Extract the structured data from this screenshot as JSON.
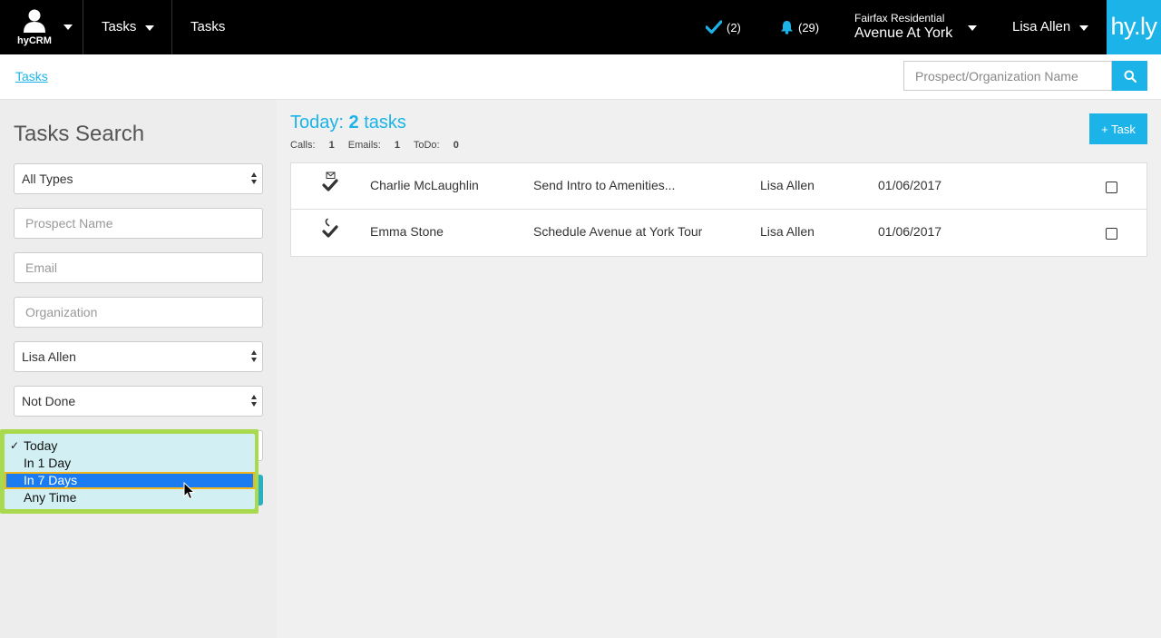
{
  "nav": {
    "brand_label": "hyCRM",
    "tasks_menu": "Tasks",
    "page_title": "Tasks",
    "tasks_count": "(2)",
    "notifications_count": "(29)",
    "company_small": "Fairfax Residential",
    "company_name": "Avenue At York",
    "user_name": "Lisa Allen",
    "logo": "hy.ly",
    "accent_color": "#1cb4e8"
  },
  "breadcrumb": {
    "link": "Tasks"
  },
  "top_search": {
    "placeholder": "Prospect/Organization Name",
    "icon": "search-icon"
  },
  "sidebar": {
    "title": "Tasks Search",
    "type_select": "All Types",
    "prospect_placeholder": "Prospect Name",
    "email_placeholder": "Email",
    "organization_placeholder": "Organization",
    "owner_select": "Lisa Allen",
    "status_select": "Not Done"
  },
  "date_dropdown": {
    "options": [
      {
        "label": "Today",
        "checked": true
      },
      {
        "label": "In 1 Day"
      },
      {
        "label": "In 7 Days",
        "highlighted": true
      },
      {
        "label": "Any Time"
      }
    ]
  },
  "main": {
    "heading_prefix": "Today:",
    "heading_count": "2",
    "heading_suffix": "tasks",
    "calls_label": "Calls:",
    "calls_value": "1",
    "emails_label": "Emails:",
    "emails_value": "1",
    "todo_label": "ToDo:",
    "todo_value": "0",
    "add_task_label": "+ Task"
  },
  "tasks": [
    {
      "icon": "email-check-icon",
      "name": "Charlie McLaughlin",
      "subject": "Send Intro to Amenities...",
      "owner": "Lisa Allen",
      "date": "01/06/2017"
    },
    {
      "icon": "phone-check-icon",
      "name": "Emma Stone",
      "subject": "Schedule Avenue at York Tour",
      "owner": "Lisa Allen",
      "date": "01/06/2017"
    }
  ]
}
